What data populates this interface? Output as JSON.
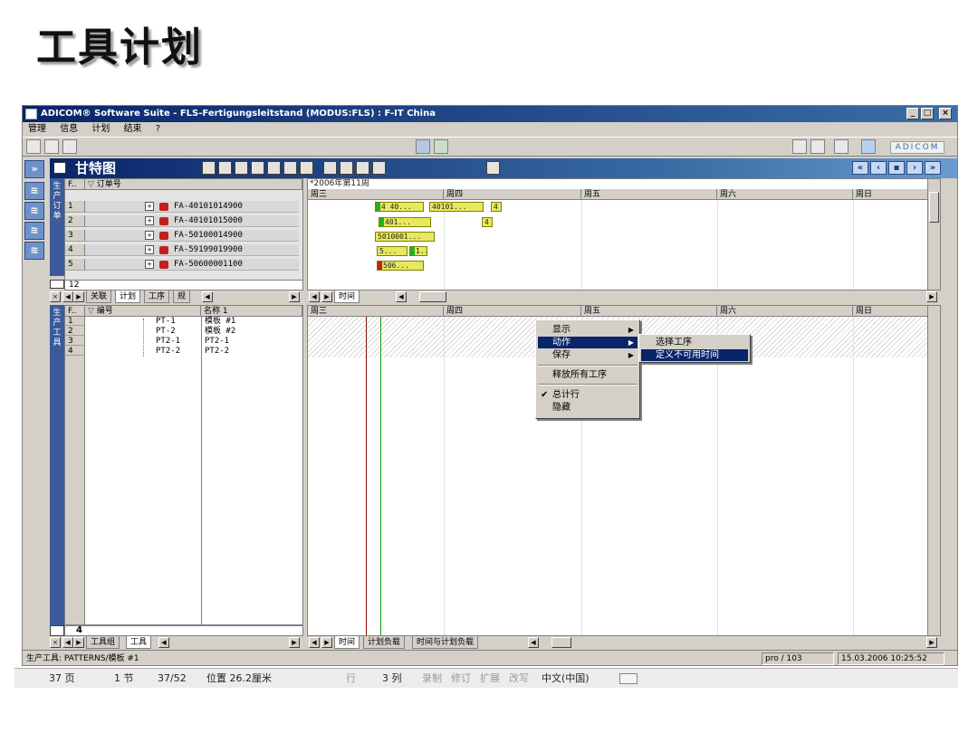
{
  "slide": {
    "title": "工具计划"
  },
  "window": {
    "title": "ADICOM® Software Suite - FLS-Fertigungsleitstand (MODUS:FLS) : F-IT China",
    "menu": [
      "管理",
      "信息",
      "计划",
      "结束",
      "?"
    ],
    "brand": "ADICOM"
  },
  "gantt": {
    "title": "甘特图"
  },
  "top_grid": {
    "vtab_label": "生产订单",
    "columns": [
      "F..",
      "订单号"
    ],
    "rows": [
      {
        "num": "1",
        "order": "FA-40101014900"
      },
      {
        "num": "2",
        "order": "FA-40101015000"
      },
      {
        "num": "3",
        "order": "FA-50100014900"
      },
      {
        "num": "4",
        "order": "FA-59199019900"
      },
      {
        "num": "5",
        "order": "FA-50600001100"
      }
    ],
    "count": "12",
    "tabs": [
      "关联",
      "计划",
      "工序",
      "规"
    ]
  },
  "top_timeline": {
    "week_label": "*2006年第11周",
    "days": [
      "周三",
      "周四",
      "周五",
      "周六",
      "周日"
    ],
    "bars": [
      {
        "row": 1,
        "label": "4 40..."
      },
      {
        "row": 1,
        "label": "40101..."
      },
      {
        "row": 1,
        "label": "4"
      },
      {
        "row": 2,
        "label": "401..."
      },
      {
        "row": 2,
        "label": "4"
      },
      {
        "row": 3,
        "label": "5010001..."
      },
      {
        "row": 4,
        "label": "5..."
      },
      {
        "row": 4,
        "label": "1..."
      },
      {
        "row": 5,
        "label": "506..."
      }
    ],
    "tabs": [
      "时间"
    ]
  },
  "bottom_grid": {
    "vtab_label": "生产工具",
    "columns": [
      "F..",
      "编号",
      "名称 1"
    ],
    "rows": [
      {
        "num": "1",
        "code": "PT-1",
        "name": "模板 #1"
      },
      {
        "num": "2",
        "code": "PT-2",
        "name": "模板 #2"
      },
      {
        "num": "3",
        "code": "PT2-1",
        "name": "PT2-1"
      },
      {
        "num": "4",
        "code": "PT2-2",
        "name": "PT2-2"
      }
    ],
    "count": "4",
    "tabs": [
      "工具组",
      "工具"
    ]
  },
  "bottom_timeline": {
    "days": [
      "周三",
      "周四",
      "周五",
      "周六",
      "周日"
    ],
    "tabs": [
      "时间",
      "计划负载",
      "时间与计划负载"
    ]
  },
  "context_menu": {
    "items": [
      {
        "label": "显示",
        "submenu": true
      },
      {
        "label": "动作",
        "submenu": true,
        "selected": true
      },
      {
        "label": "保存",
        "submenu": true
      },
      {
        "label": "释放所有工序"
      },
      {
        "label": "总计行",
        "checked": true
      },
      {
        "label": "隐藏"
      }
    ],
    "submenu": [
      {
        "label": "选择工序"
      },
      {
        "label": "定义不可用时间",
        "selected": true
      }
    ]
  },
  "statusbar": {
    "left": "生产工具: PATTERNS/模板 #1",
    "user": "pro / 103",
    "datetime": "15.03.2006  10:25:52"
  },
  "word_status": {
    "page": "37 页",
    "section": "1 节",
    "pages": "37/52",
    "position": "位置 26.2厘米",
    "line": "行",
    "col": "3 列",
    "rec": "录制",
    "trk": "修订",
    "ext": "扩展",
    "ovr": "改写",
    "lang": "中文(中国)"
  },
  "colors": {
    "titlebar": "#0a246a",
    "selection": "#0a246a",
    "bar_yellow": "#e8e860",
    "bar_green": "#22b022"
  }
}
